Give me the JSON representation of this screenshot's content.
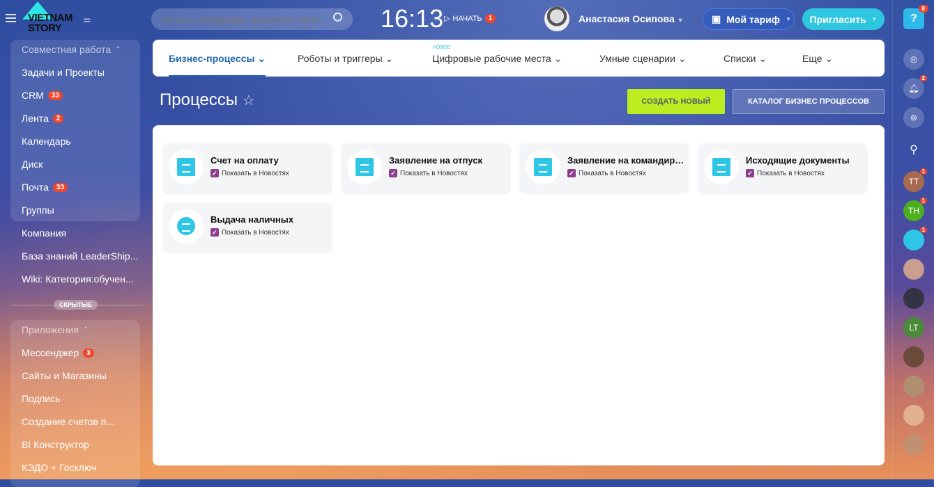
{
  "header": {
    "logo": "VIETNAM STORY",
    "search_placeholder": "искать сотрудника, документ, проч...",
    "time": "16:13",
    "start_label": "НАЧАТЬ",
    "start_badge": "1",
    "user_name": "Анастасия Осипова",
    "tariff_label": "Мой тариф",
    "invite_label": "Пригласить"
  },
  "sidebar": {
    "group1_title": "Совместная работа",
    "group1": [
      {
        "label": "Задачи и Проекты"
      },
      {
        "label": "CRM",
        "badge": "33"
      },
      {
        "label": "Лента",
        "badge": "2"
      },
      {
        "label": "Календарь"
      },
      {
        "label": "Диск"
      },
      {
        "label": "Почта",
        "badge": "33"
      },
      {
        "label": "Группы"
      }
    ],
    "loose": [
      {
        "label": "Компания"
      },
      {
        "label": "База знаний LeaderShip..."
      },
      {
        "label": "Wiki: Категория:обучен..."
      }
    ],
    "hidden_label": "СКРЫТЫЕ",
    "group2_title": "Приложения",
    "group2": [
      {
        "label": "Мессенджер",
        "badge": "3"
      },
      {
        "label": "Сайты и Магазины"
      },
      {
        "label": "Подпись"
      },
      {
        "label": "Создание счетов п..."
      },
      {
        "label": "BI Конструктор"
      },
      {
        "label": "КЭДО + Госключ"
      }
    ]
  },
  "tabs": {
    "new_label": "НОВОЕ",
    "items": [
      "Бизнес-процессы",
      "Роботы и триггеры",
      "Цифровые рабочие места",
      "Умные сценарии",
      "Списки",
      "Еще"
    ]
  },
  "page": {
    "title": "Процессы",
    "create_label": "СОЗДАТЬ НОВЫЙ",
    "catalog_label": "КАТАЛОГ БИЗНЕС ПРОЦЕССОВ"
  },
  "cards": [
    {
      "name": "Счет на оплату",
      "check": "Показать в Новостях"
    },
    {
      "name": "Заявление на отпуск",
      "check": "Показать в Новостях"
    },
    {
      "name": "Заявление на командировку",
      "check": "Показать в Новостях"
    },
    {
      "name": "Исходящие документы",
      "check": "Показать в Новостях"
    },
    {
      "name": "Выдача наличных",
      "check": "Показать в Новостях"
    }
  ],
  "right": {
    "help_badge": "8",
    "bell_badge": "2",
    "contacts": [
      {
        "initials": "TT",
        "badge": "1",
        "color": "#a86a4e"
      },
      {
        "initials": "TH",
        "badge": "1",
        "color": "#4caf20"
      },
      {
        "initials": "",
        "badge": "1",
        "color": "#2fc6e6"
      },
      {
        "initials": "",
        "color": "#c9a090"
      },
      {
        "initials": "",
        "color": "#334"
      },
      {
        "initials": "LT",
        "color": "#4a8a3a"
      },
      {
        "initials": "",
        "color": "#6a4a3a"
      },
      {
        "initials": "",
        "color": "#b09070"
      },
      {
        "initials": "",
        "color": "#e0b090"
      },
      {
        "initials": "",
        "color": "#c09070"
      }
    ]
  }
}
